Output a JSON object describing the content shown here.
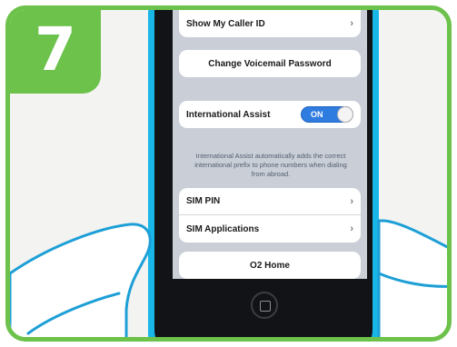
{
  "badge": {
    "number": "7"
  },
  "settings": {
    "caller_id": {
      "label": "Show My Caller ID",
      "chevron": "›"
    },
    "voicemail": {
      "label": "Change Voicemail Password"
    },
    "international_assist": {
      "label": "International Assist",
      "toggle_text": "ON",
      "footer": "International Assist automatically adds the correct international prefix to phone numbers when dialing from abroad."
    },
    "sim_pin": {
      "label": "SIM PIN",
      "chevron": "›"
    },
    "sim_apps": {
      "label": "SIM Applications",
      "chevron": "›"
    },
    "o2_home": {
      "label": "O2 Home"
    }
  },
  "colors": {
    "frame": "#6cc24a",
    "phone": "#19b6e8",
    "toggle": "#2f7ce0"
  }
}
